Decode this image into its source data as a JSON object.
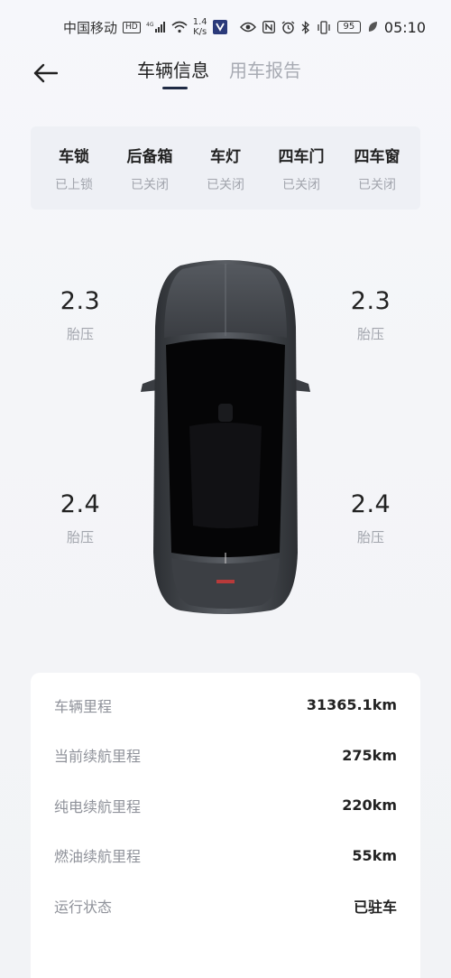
{
  "status_bar": {
    "carrier": "中国移动",
    "hd": "HD",
    "network": "4G",
    "speed_top": "1.4",
    "speed_bottom": "K/s",
    "battery": "95",
    "time": "05:10"
  },
  "header": {
    "tabs": [
      {
        "label": "车辆信息",
        "active": true
      },
      {
        "label": "用车报告",
        "active": false
      }
    ]
  },
  "vehicle_status": [
    {
      "label": "车锁",
      "value": "已上锁"
    },
    {
      "label": "后备箱",
      "value": "已关闭"
    },
    {
      "label": "车灯",
      "value": "已关闭"
    },
    {
      "label": "四车门",
      "value": "已关闭"
    },
    {
      "label": "四车窗",
      "value": "已关闭"
    }
  ],
  "tires": {
    "front_left": {
      "value": "2.3",
      "label": "胎压"
    },
    "front_right": {
      "value": "2.3",
      "label": "胎压"
    },
    "rear_left": {
      "value": "2.4",
      "label": "胎压"
    },
    "rear_right": {
      "value": "2.4",
      "label": "胎压"
    }
  },
  "mileage": [
    {
      "label": "车辆里程",
      "value": "31365.1km"
    },
    {
      "label": "当前续航里程",
      "value": "275km"
    },
    {
      "label": "纯电续航里程",
      "value": "220km"
    },
    {
      "label": "燃油续航里程",
      "value": "55km"
    },
    {
      "label": "运行状态",
      "value": "已驻车"
    }
  ],
  "colors": {
    "accent": "#1f2a44",
    "muted": "#a2a5ad",
    "panel": "#eef0f5",
    "car_body": "#4a4d52"
  }
}
